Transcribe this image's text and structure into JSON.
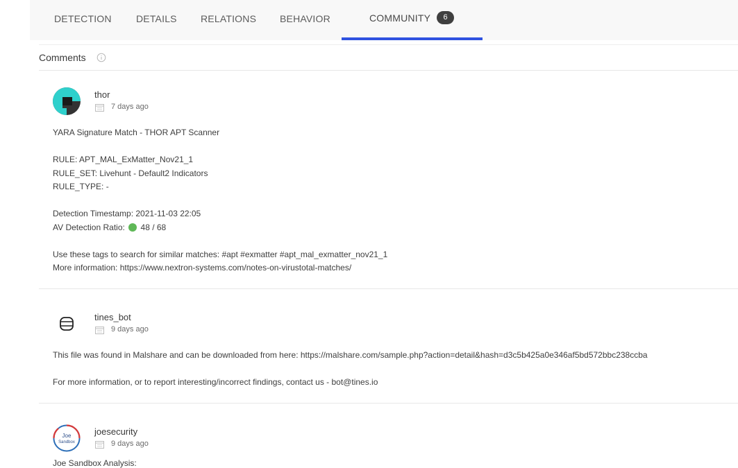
{
  "tabs": [
    {
      "label": "DETECTION"
    },
    {
      "label": "DETAILS"
    },
    {
      "label": "RELATIONS"
    },
    {
      "label": "BEHAVIOR"
    },
    {
      "label": "COMMUNITY",
      "count": "6",
      "active": true
    }
  ],
  "section": {
    "title": "Comments"
  },
  "comments": [
    {
      "author": "thor",
      "time": "7 days ago",
      "lines": {
        "l1": "YARA Signature Match - THOR APT Scanner",
        "l2": "RULE: APT_MAL_ExMatter_Nov21_1",
        "l3": "RULE_SET: Livehunt - Default2 Indicators",
        "l4": "RULE_TYPE: -",
        "l5": "Detection Timestamp: 2021-11-03 22:05",
        "l6_prefix": "AV Detection Ratio: ",
        "l6_value": "48 / 68",
        "l7_prefix": "Use these tags to search for similar matches: ",
        "tag1": "#apt",
        "tag2": "#exmatter",
        "tag3": "#apt_mal_exmatter_nov21_1",
        "l8_prefix": "More information: ",
        "l8_link": "https://www.nextron-systems.com/notes-on-virustotal-matches/"
      }
    },
    {
      "author": "tines_bot",
      "time": "9 days ago",
      "lines": {
        "l1_prefix": "This file was found in Malshare and can be downloaded from here: ",
        "l1_link": "https://malshare.com/sample.php?action=detail&hash=d3c5b425a0e346af5bd572bbc238ccba",
        "l2": "For more information, or to report interesting/incorrect findings, contact us - bot@tines.io"
      }
    },
    {
      "author": "joesecurity",
      "time": "9 days ago",
      "lines": {
        "l1": "Joe Sandbox Analysis:"
      },
      "avatar_text": {
        "a": "Joe",
        "b": "Sandbox"
      }
    }
  ],
  "colors": {
    "accent": "#2f52e0",
    "badge": "#3f3f3f",
    "ratio_dot": "#5fb857"
  }
}
